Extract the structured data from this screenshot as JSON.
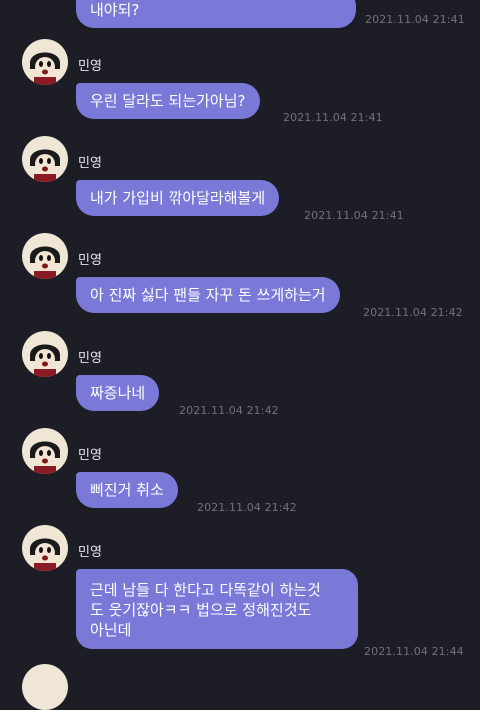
{
  "messages": [
    {
      "sender": "",
      "text": "내야되?",
      "time": "2021.11.04 21:41"
    },
    {
      "sender": "민영",
      "text": "우린 달라도 되는가아님?",
      "time": "2021.11.04 21:41"
    },
    {
      "sender": "민영",
      "text": "내가 가입비 깎아달라해볼게",
      "time": "2021.11.04 21:41"
    },
    {
      "sender": "민영",
      "text": "아 진짜 싫다 팬들 자꾸 돈 쓰게하는거",
      "time": "2021.11.04 21:42"
    },
    {
      "sender": "민영",
      "text": "짜증나네",
      "time": "2021.11.04 21:42"
    },
    {
      "sender": "민영",
      "text": "삐진거 취소",
      "time": "2021.11.04 21:42"
    },
    {
      "sender": "민영",
      "lines": [
        "근데 남들 다 한다고 다똑같이 하는것",
        "도 웃기잖아ㅋㅋ 법으로 정해진것도",
        "아닌데"
      ],
      "time": "2021.11.04 21:44"
    }
  ],
  "colors": {
    "background": "#1d1e25",
    "bubble": "#7b79d8",
    "time": "#70717c",
    "name": "#e4e4ea"
  },
  "icons": {
    "avatar": "cartoon-character-avatar"
  }
}
